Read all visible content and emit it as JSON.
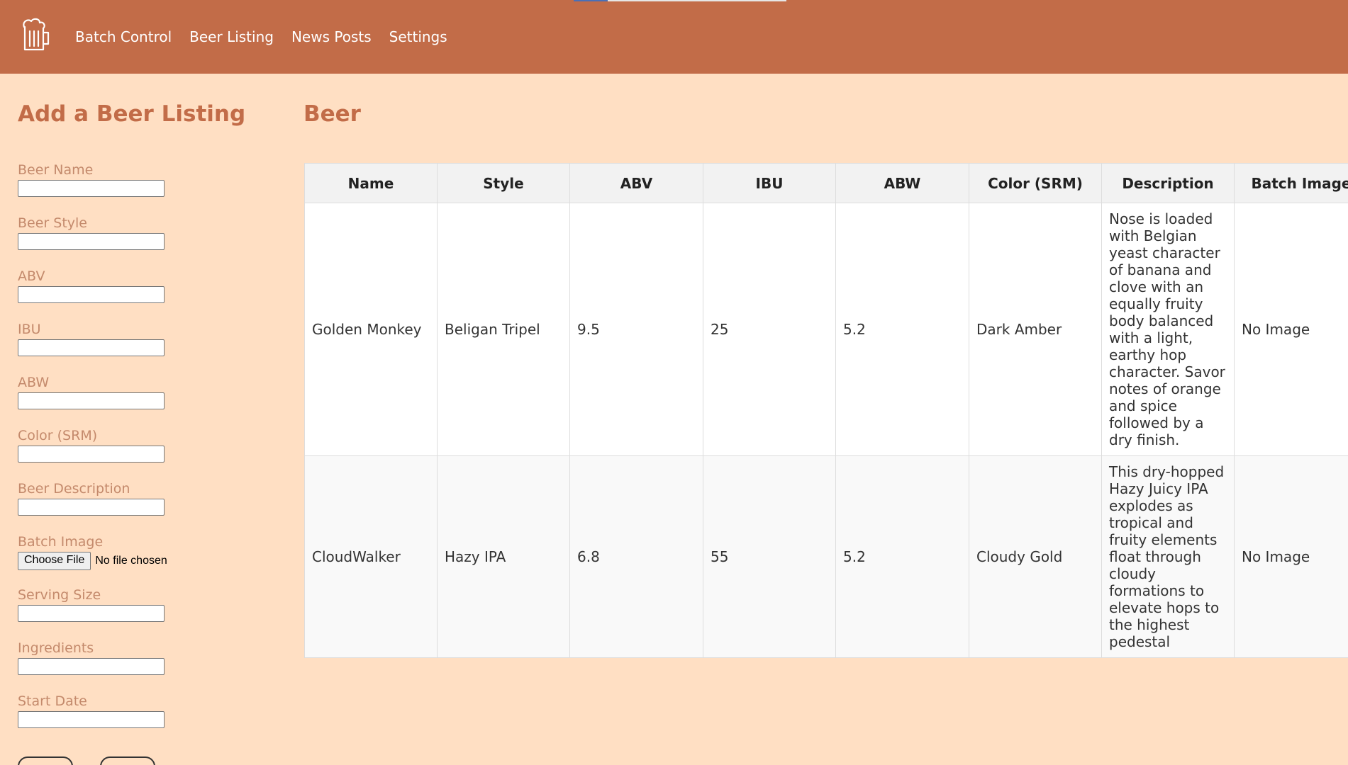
{
  "nav": {
    "items": [
      {
        "label": "Batch Control"
      },
      {
        "label": "Beer Listing"
      },
      {
        "label": "News Posts"
      },
      {
        "label": "Settings"
      }
    ],
    "logo_icon": "beer-mug-icon",
    "load_progress": 0.16
  },
  "form": {
    "title": "Add a Beer Listing",
    "fields": {
      "beer_name": {
        "label": "Beer Name",
        "value": ""
      },
      "beer_style": {
        "label": "Beer Style",
        "value": ""
      },
      "abv": {
        "label": "ABV",
        "value": ""
      },
      "ibu": {
        "label": "IBU",
        "value": ""
      },
      "abw": {
        "label": "ABW",
        "value": ""
      },
      "color": {
        "label": "Color (SRM)",
        "value": ""
      },
      "description": {
        "label": "Beer Description",
        "value": ""
      },
      "batch_image": {
        "label": "Batch Image",
        "button": "Choose File",
        "status": "No file chosen"
      },
      "serving_size": {
        "label": "Serving Size",
        "value": ""
      },
      "ingredients": {
        "label": "Ingredients",
        "value": ""
      },
      "start_date": {
        "label": "Start Date",
        "value": ""
      }
    }
  },
  "list": {
    "title": "Beer",
    "columns": [
      "Name",
      "Style",
      "ABV",
      "IBU",
      "ABW",
      "Color (SRM)",
      "Description",
      "Batch Image"
    ],
    "rows": [
      {
        "name": "Golden Monkey",
        "style": "Beligan Tripel",
        "abv": "9.5",
        "ibu": "25",
        "abw": "5.2",
        "color": "Dark Amber",
        "description": "Nose is loaded with Belgian yeast character of banana and clove with an equally fruity body balanced with a light, earthy hop character. Savor notes of orange and spice followed by a dry finish.",
        "image": "No Image"
      },
      {
        "name": "CloudWalker",
        "style": "Hazy IPA",
        "abv": "6.8",
        "ibu": "55",
        "abw": "5.2",
        "color": "Cloudy Gold",
        "description": "This dry-hopped Hazy Juicy IPA explodes as tropical and fruity elements float through cloudy formations to elevate hops to the highest pedestal",
        "image": "No Image"
      }
    ]
  },
  "colors": {
    "navbar": "#c26c48",
    "background": "#ffdfc3",
    "accent_text": "#c26c48",
    "label_text": "#c48a6c"
  }
}
